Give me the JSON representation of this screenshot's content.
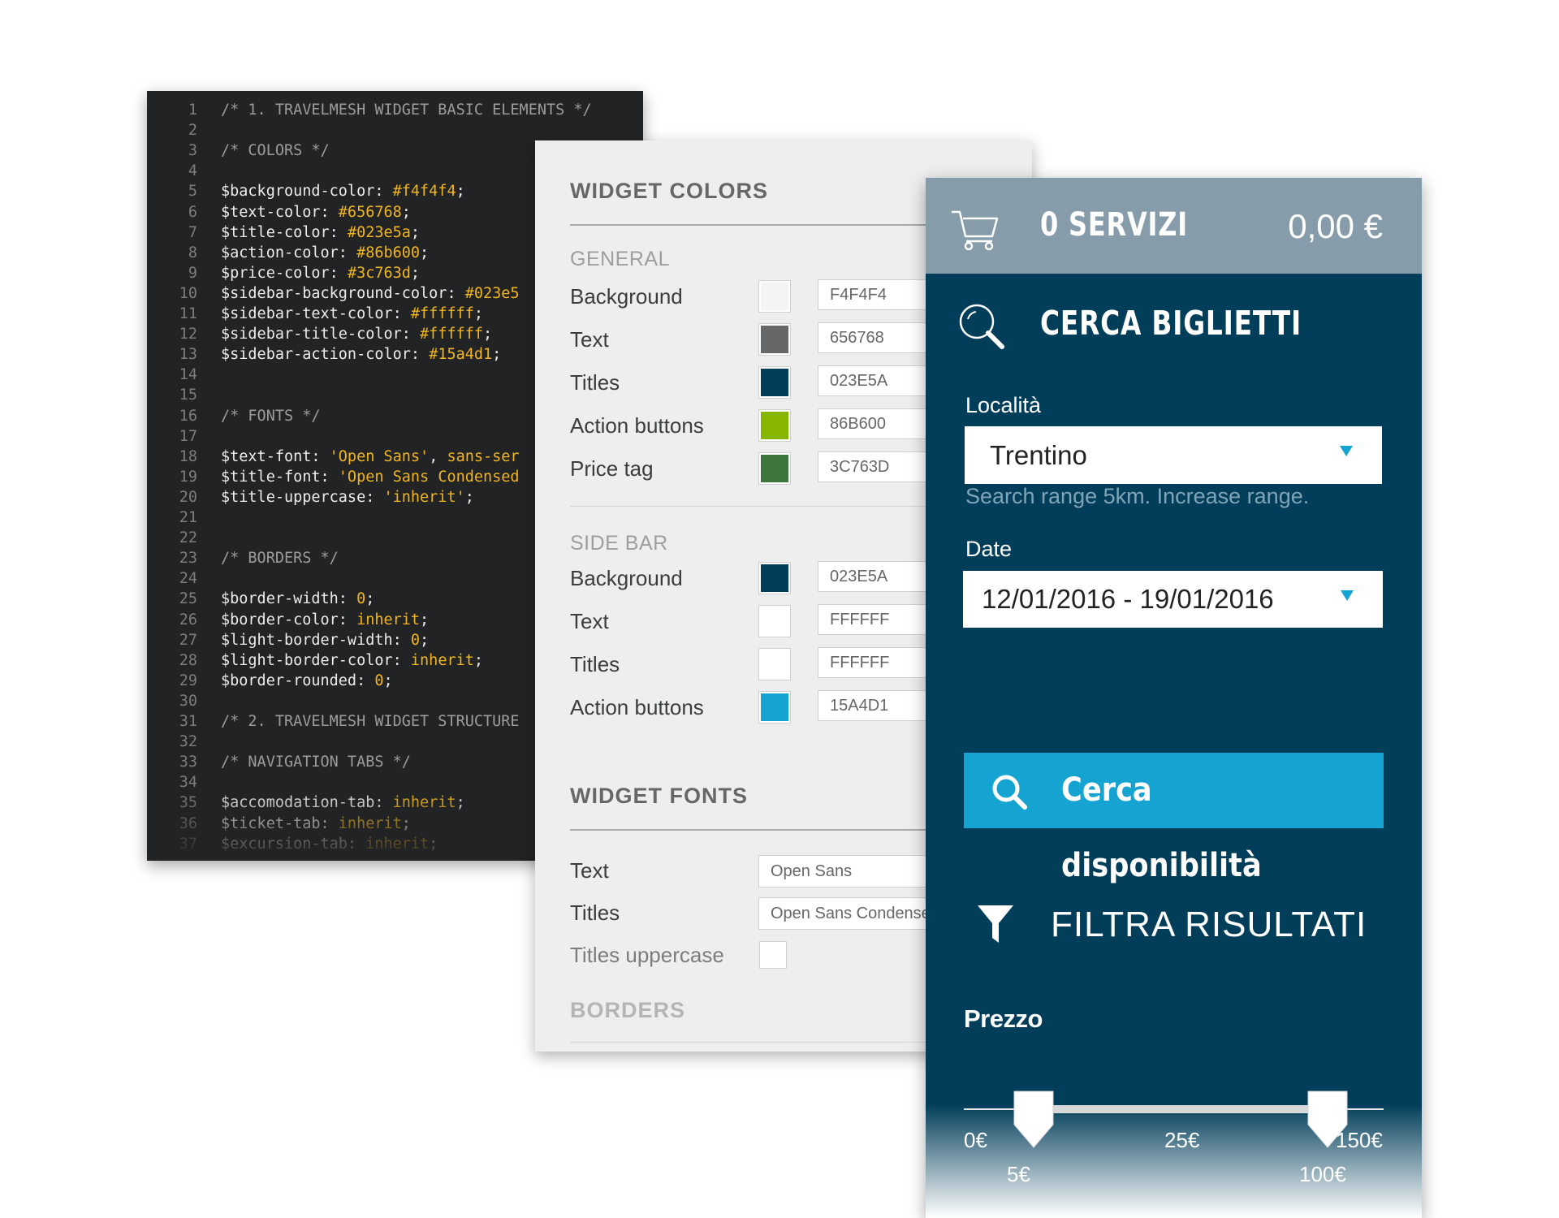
{
  "editor": {
    "lines": [
      {
        "n": "1",
        "parts": [
          {
            "t": "/* 1. TRAVELMESH WIDGET BASIC ELEMENTS */",
            "c": "c-comment"
          }
        ]
      },
      {
        "n": "2",
        "parts": []
      },
      {
        "n": "3",
        "parts": [
          {
            "t": "/* COLORS */",
            "c": "c-comment"
          }
        ]
      },
      {
        "n": "4",
        "parts": []
      },
      {
        "n": "5",
        "parts": [
          {
            "t": "$background-color: ",
            "c": "c-var"
          },
          {
            "t": "#f4f4f4",
            "c": "c-val"
          },
          {
            "t": ";",
            "c": "c-var"
          }
        ]
      },
      {
        "n": "6",
        "parts": [
          {
            "t": "$text-color: ",
            "c": "c-var"
          },
          {
            "t": "#656768",
            "c": "c-val"
          },
          {
            "t": ";",
            "c": "c-var"
          }
        ]
      },
      {
        "n": "7",
        "parts": [
          {
            "t": "$title-color: ",
            "c": "c-var"
          },
          {
            "t": "#023e5a",
            "c": "c-val"
          },
          {
            "t": ";",
            "c": "c-var"
          }
        ]
      },
      {
        "n": "8",
        "parts": [
          {
            "t": "$action-color: ",
            "c": "c-var"
          },
          {
            "t": "#86b600",
            "c": "c-val"
          },
          {
            "t": ";",
            "c": "c-var"
          }
        ]
      },
      {
        "n": "9",
        "parts": [
          {
            "t": "$price-color: ",
            "c": "c-var"
          },
          {
            "t": "#3c763d",
            "c": "c-val"
          },
          {
            "t": ";",
            "c": "c-var"
          }
        ]
      },
      {
        "n": "10",
        "parts": [
          {
            "t": "$sidebar-background-color: ",
            "c": "c-var"
          },
          {
            "t": "#023e5",
            "c": "c-val"
          }
        ]
      },
      {
        "n": "11",
        "parts": [
          {
            "t": "$sidebar-text-color: ",
            "c": "c-var"
          },
          {
            "t": "#ffffff",
            "c": "c-val"
          },
          {
            "t": ";",
            "c": "c-var"
          }
        ]
      },
      {
        "n": "12",
        "parts": [
          {
            "t": "$sidebar-title-color: ",
            "c": "c-var"
          },
          {
            "t": "#ffffff",
            "c": "c-val"
          },
          {
            "t": ";",
            "c": "c-var"
          }
        ]
      },
      {
        "n": "13",
        "parts": [
          {
            "t": "$sidebar-action-color: ",
            "c": "c-var"
          },
          {
            "t": "#15a4d1",
            "c": "c-val"
          },
          {
            "t": ";",
            "c": "c-var"
          }
        ]
      },
      {
        "n": "14",
        "parts": []
      },
      {
        "n": "15",
        "parts": []
      },
      {
        "n": "16",
        "parts": [
          {
            "t": "/* FONTS */",
            "c": "c-comment"
          }
        ]
      },
      {
        "n": "17",
        "parts": []
      },
      {
        "n": "18",
        "parts": [
          {
            "t": "$text-font: ",
            "c": "c-var"
          },
          {
            "t": "'Open Sans'",
            "c": "c-str"
          },
          {
            "t": ", ",
            "c": "c-var"
          },
          {
            "t": "sans-ser",
            "c": "c-val"
          }
        ]
      },
      {
        "n": "19",
        "parts": [
          {
            "t": "$title-font: ",
            "c": "c-var"
          },
          {
            "t": "'Open Sans Condensed",
            "c": "c-str"
          }
        ]
      },
      {
        "n": "20",
        "parts": [
          {
            "t": "$title-uppercase: ",
            "c": "c-var"
          },
          {
            "t": "'inherit'",
            "c": "c-str"
          },
          {
            "t": ";",
            "c": "c-var"
          }
        ]
      },
      {
        "n": "21",
        "parts": []
      },
      {
        "n": "22",
        "parts": []
      },
      {
        "n": "23",
        "parts": [
          {
            "t": "/* BORDERS */",
            "c": "c-comment"
          }
        ]
      },
      {
        "n": "24",
        "parts": []
      },
      {
        "n": "25",
        "parts": [
          {
            "t": "$border-width: ",
            "c": "c-var"
          },
          {
            "t": "0",
            "c": "c-val"
          },
          {
            "t": ";",
            "c": "c-var"
          }
        ]
      },
      {
        "n": "26",
        "parts": [
          {
            "t": "$border-color: ",
            "c": "c-var"
          },
          {
            "t": "inherit",
            "c": "c-val"
          },
          {
            "t": ";",
            "c": "c-var"
          }
        ]
      },
      {
        "n": "27",
        "parts": [
          {
            "t": "$light-border-width: ",
            "c": "c-var"
          },
          {
            "t": "0",
            "c": "c-val"
          },
          {
            "t": ";",
            "c": "c-var"
          }
        ]
      },
      {
        "n": "28",
        "parts": [
          {
            "t": "$light-border-color: ",
            "c": "c-var"
          },
          {
            "t": "inherit",
            "c": "c-val"
          },
          {
            "t": ";",
            "c": "c-var"
          }
        ]
      },
      {
        "n": "29",
        "parts": [
          {
            "t": "$border-rounded: ",
            "c": "c-var"
          },
          {
            "t": "0",
            "c": "c-val"
          },
          {
            "t": ";",
            "c": "c-var"
          }
        ]
      },
      {
        "n": "30",
        "parts": []
      },
      {
        "n": "31",
        "parts": [
          {
            "t": "/* 2. TRAVELMESH WIDGET STRUCTURE",
            "c": "c-comment"
          }
        ]
      },
      {
        "n": "32",
        "parts": []
      },
      {
        "n": "33",
        "parts": [
          {
            "t": "/* NAVIGATION TABS */",
            "c": "c-comment"
          }
        ]
      },
      {
        "n": "34",
        "parts": []
      },
      {
        "n": "35",
        "parts": [
          {
            "t": "$accomodation-tab: ",
            "c": "c-var"
          },
          {
            "t": "inherit",
            "c": "c-val"
          },
          {
            "t": ";",
            "c": "c-var"
          }
        ]
      },
      {
        "n": "36",
        "parts": [
          {
            "t": "$ticket-tab: ",
            "c": "c-var"
          },
          {
            "t": "inherit",
            "c": "c-val"
          },
          {
            "t": ";",
            "c": "c-var"
          }
        ]
      },
      {
        "n": "37",
        "parts": [
          {
            "t": "$excursion-tab: ",
            "c": "c-var"
          },
          {
            "t": "inherit",
            "c": "c-val"
          },
          {
            "t": ";",
            "c": "c-var"
          }
        ]
      }
    ]
  },
  "settings": {
    "title": "WIDGET COLORS",
    "general": {
      "heading": "GENERAL",
      "rows": [
        {
          "label": "Background",
          "color": "#F4F4F4",
          "hex": "F4F4F4"
        },
        {
          "label": "Text",
          "color": "#656768",
          "hex": "656768"
        },
        {
          "label": "Titles",
          "color": "#023E5A",
          "hex": "023E5A"
        },
        {
          "label": "Action buttons",
          "color": "#86B600",
          "hex": "86B600"
        },
        {
          "label": "Price tag",
          "color": "#3C763D",
          "hex": "3C763D"
        }
      ]
    },
    "sidebar": {
      "heading": "SIDE BAR",
      "rows": [
        {
          "label": "Background",
          "color": "#023E5A",
          "hex": "023E5A"
        },
        {
          "label": "Text",
          "color": "#FFFFFF",
          "hex": "FFFFFF"
        },
        {
          "label": "Titles",
          "color": "#FFFFFF",
          "hex": "FFFFFF"
        },
        {
          "label": "Action buttons",
          "color": "#15A4D1",
          "hex": "15A4D1"
        }
      ]
    },
    "fonts": {
      "title": "WIDGET FONTS",
      "text_label": "Text",
      "text_value": "Open Sans",
      "titles_label": "Titles",
      "titles_value": "Open Sans Condensed",
      "uppercase_label": "Titles uppercase"
    },
    "borders_title": "BORDERS"
  },
  "widget": {
    "cart": {
      "count": "0 SERVIZI",
      "total": "0,00 €"
    },
    "search_title": "CERCA BIGLIETTI",
    "location": {
      "label": "Località",
      "value": "Trentino"
    },
    "range_hint": "Search range 5km. Increase range.",
    "date": {
      "label": "Date",
      "value": "12/01/2016 - 19/01/2016"
    },
    "search_button": "Cerca disponibilità",
    "filter_title": "FILTRA RISULTATI",
    "price": {
      "label": "Prezzo",
      "min_label": "0€",
      "mid_label": "25€",
      "max_label": "150€",
      "low_value": "5€",
      "high_value": "100€"
    },
    "colors": {
      "background": "#023E5A",
      "cart_bar": "#879CAB",
      "action": "#15A4D1"
    }
  }
}
